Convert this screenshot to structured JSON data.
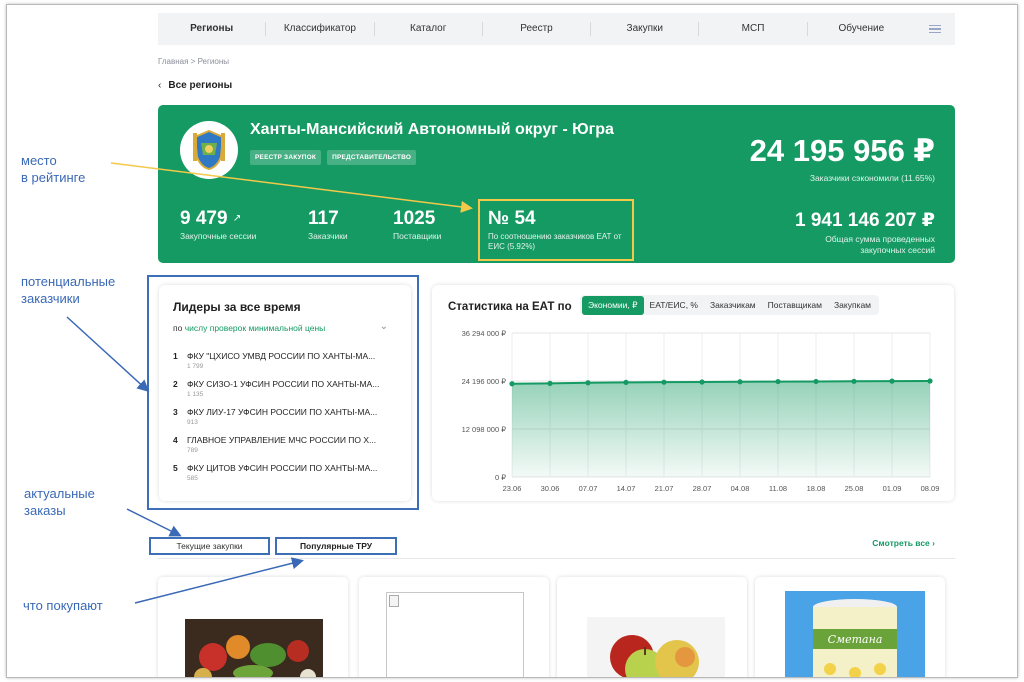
{
  "nav": {
    "items": [
      "Регионы",
      "Классификатор",
      "Каталог",
      "Реестр",
      "Закупки",
      "МСП",
      "Обучение"
    ],
    "active": 0,
    "menu_icon": "hamburger-icon"
  },
  "breadcrumb": "Главная > Регионы",
  "back_link": "Все регионы",
  "region": {
    "title": "Ханты-Мансийский Автономный округ - Югра",
    "tags": [
      "РЕЕСТР ЗАКУПОК",
      "ПРЕДСТАВИТЕЛЬСТВО"
    ],
    "savings": "24 195 956 ₽",
    "savings_label": "Заказчики сэкономили (11.65%)",
    "sessions": "9 479",
    "sessions_label": "Закупочные сессии",
    "customers": "117",
    "customers_label": "Заказчики",
    "suppliers": "1025",
    "suppliers_label": "Поставщики",
    "rank": "№ 54",
    "rank_label": "По соотношению заказчиков ЕАТ от ЕИС (5.92%)",
    "total_sum": "1 941 146 207 ₽",
    "total_sum_label": "Общая сумма проведенных закупочных сессий"
  },
  "leaders": {
    "title": "Лидеры за все время",
    "filter_prefix": "по",
    "filter_value": "числу проверок минимальной цены",
    "items": [
      {
        "rank": "1",
        "name": "ФКУ \"ЦХИСО УМВД РОССИИ ПО ХАНТЫ-МА...",
        "count": "1 799"
      },
      {
        "rank": "2",
        "name": "ФКУ СИЗО-1 УФСИН РОССИИ ПО ХАНТЫ-МА...",
        "count": "1 135"
      },
      {
        "rank": "3",
        "name": "ФКУ ЛИУ-17 УФСИН РОССИИ ПО ХАНТЫ-МА...",
        "count": "913"
      },
      {
        "rank": "4",
        "name": "ГЛАВНОЕ УПРАВЛЕНИЕ МЧС РОССИИ ПО Х...",
        "count": "789"
      },
      {
        "rank": "5",
        "name": "ФКУ ЦИТОВ УФСИН РОССИИ ПО ХАНТЫ-МА...",
        "count": "585"
      }
    ]
  },
  "stats": {
    "title": "Статистика на ЕАТ по",
    "tabs": [
      "Экономии, ₽",
      "ЕАТ/ЕИС, %",
      "Заказчикам",
      "Поставщикам",
      "Закупкам"
    ],
    "active_tab": 0
  },
  "chart_data": {
    "type": "area",
    "x": [
      "23.06",
      "30.06",
      "07.07",
      "14.07",
      "21.07",
      "28.07",
      "04.08",
      "11.08",
      "18.08",
      "25.08",
      "01.09",
      "08.09"
    ],
    "series": [
      {
        "values": [
          23500000,
          23600000,
          23750000,
          23850000,
          23900000,
          23950000,
          24000000,
          24050000,
          24080000,
          24120000,
          24160000,
          24195956
        ]
      }
    ],
    "ylim": [
      0,
      36294000
    ],
    "yticks": [
      "36 294 000 ₽",
      "24 196 000 ₽",
      "12 098 000 ₽",
      "0 ₽"
    ],
    "ytick_values": [
      36294000,
      24196000,
      12098000,
      0
    ],
    "grid": true,
    "color": "#159a63"
  },
  "tabs_section": {
    "tabs": [
      "Текущие закупки",
      "Популярные ТРУ"
    ],
    "active": 1,
    "see_all": "Смотреть все"
  },
  "annotations": {
    "rank_note": [
      "место",
      "в рейтинге"
    ],
    "customers_note": [
      "потенциальные",
      "заказчики"
    ],
    "orders_note": [
      "актуальные",
      "заказы"
    ],
    "buy_note": "что покупают"
  },
  "products": [
    "vegetables-image",
    "broken-image",
    "apples-image",
    "sour-cream-image"
  ],
  "product_label": "Сметана"
}
